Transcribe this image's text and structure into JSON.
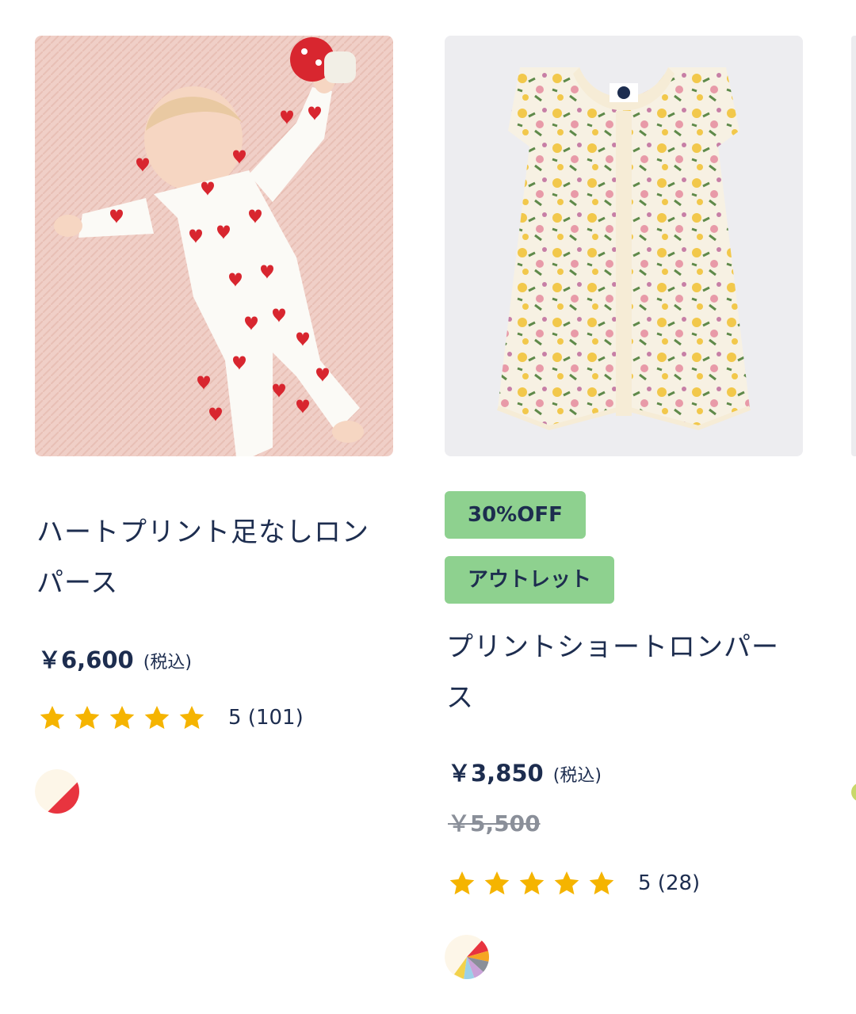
{
  "products": [
    {
      "name": "ハートプリント足なしロンパース",
      "price": "￥6,600",
      "tax_note": "(税込)",
      "rating_value": 5,
      "rating_text": "5 (101)",
      "image_icon": "baby-heart-romper-photo",
      "swatch_colors": [
        "#fdf6e8",
        "#e8343f"
      ]
    },
    {
      "badges": [
        "30%OFF",
        "アウトレット"
      ],
      "name": "プリントショートロンパース",
      "price": "￥3,850",
      "tax_note": "(税込)",
      "original_price": "￥5,500",
      "rating_value": 5,
      "rating_text": "5 (28)",
      "image_icon": "floral-short-romper-photo",
      "swatch_colors": [
        "#fdf6e8",
        "#e8343f",
        "#f5a623",
        "#9bd0e8",
        "#c9a2d8",
        "#f2d24b",
        "#8a8f99"
      ]
    }
  ],
  "colors": {
    "text": "#1d2d4f",
    "star": "#f5b400",
    "badge_bg": "#8ed18f",
    "strike": "#8a8f99"
  }
}
